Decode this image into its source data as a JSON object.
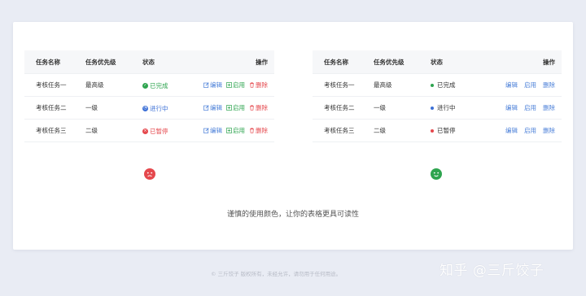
{
  "colors": {
    "success": "#2ea44f",
    "info": "#3b6fd6",
    "danger": "#e5484d",
    "edit": "#4a7fd8",
    "enable": "#2ea44f",
    "delete": "#e5484d",
    "link": "#4a7fd8"
  },
  "left_table": {
    "headers": [
      "任务名称",
      "任务优先级",
      "状态",
      "操作"
    ],
    "rows": [
      {
        "name": "考核任务一",
        "priority": "最高级",
        "status": "已完成",
        "status_icon": "check-circle-icon",
        "status_color": "#2ea44f"
      },
      {
        "name": "考核任务二",
        "priority": "一级",
        "status": "进行中",
        "status_icon": "clock-icon",
        "status_color": "#3b6fd6"
      },
      {
        "name": "考核任务三",
        "priority": "二级",
        "status": "已暂停",
        "status_icon": "x-circle-icon",
        "status_color": "#e5484d"
      }
    ],
    "actions": {
      "edit": "编辑",
      "enable": "启用",
      "delete": "删除"
    }
  },
  "right_table": {
    "headers": [
      "任务名称",
      "任务优先级",
      "状态",
      "操作"
    ],
    "rows": [
      {
        "name": "考核任务一",
        "priority": "最高级",
        "status": "已完成",
        "dot_color": "#2ea44f"
      },
      {
        "name": "考核任务二",
        "priority": "一级",
        "status": "进行中",
        "dot_color": "#3b6fd6"
      },
      {
        "name": "考核任务三",
        "priority": "二级",
        "status": "已暂停",
        "dot_color": "#e5484d"
      }
    ],
    "actions": {
      "edit": "编辑",
      "enable": "启用",
      "delete": "删除"
    }
  },
  "faces": {
    "left": {
      "icon": "sad-face-icon",
      "color": "#e5484d"
    },
    "right": {
      "icon": "happy-face-icon",
      "color": "#2ea44f"
    }
  },
  "caption": "谨慎的使用颜色，让你的表格更具可读性",
  "footer": "© 三斤饺子  版权所有，未经允许，请勿用于任何用途。",
  "watermark": "知乎 @三斤饺子"
}
